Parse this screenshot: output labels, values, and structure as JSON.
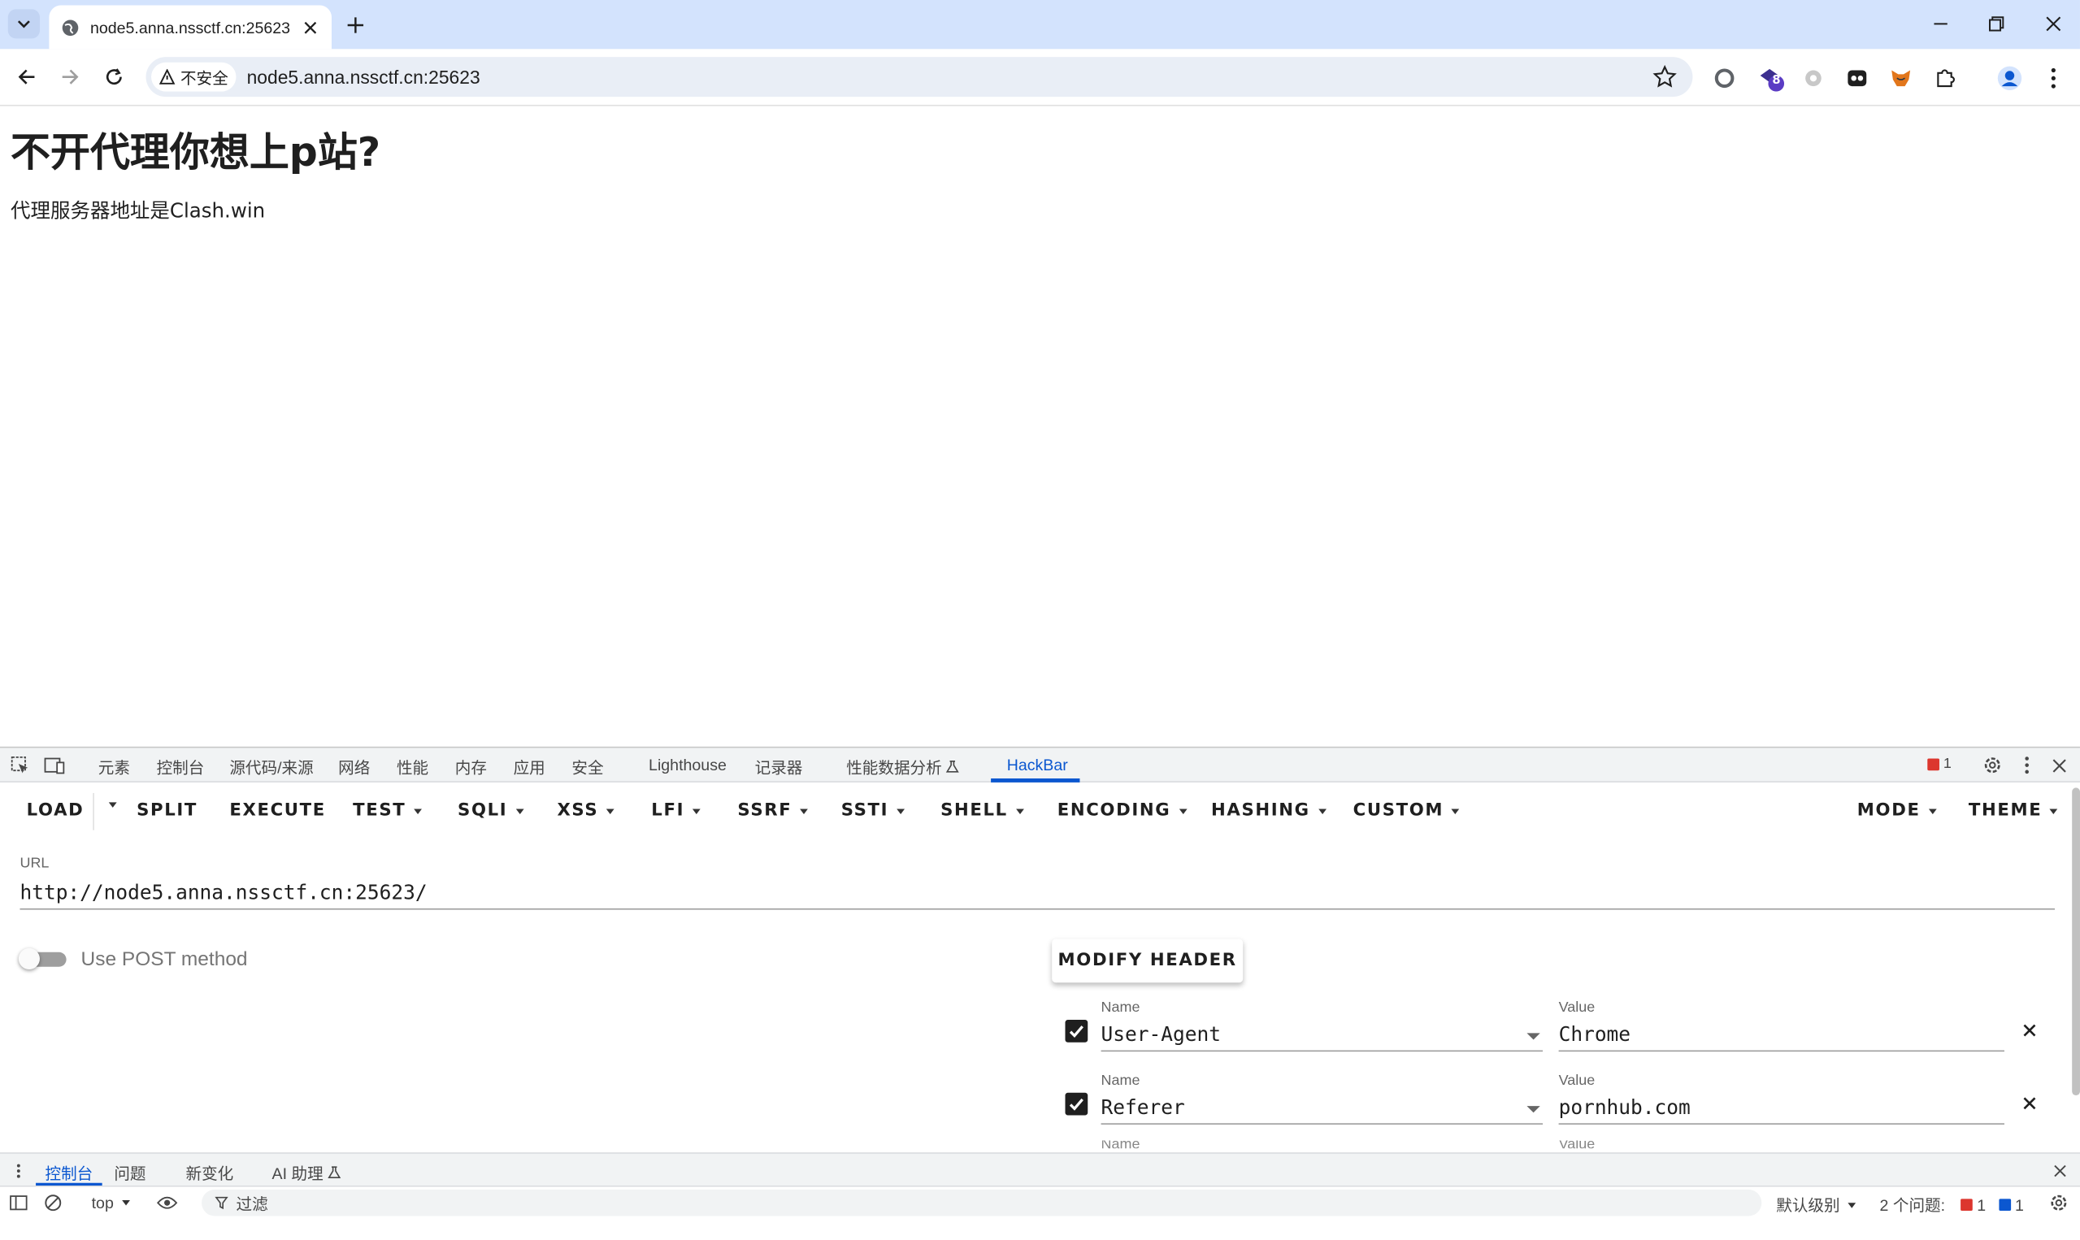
{
  "browser": {
    "tab_title": "node5.anna.nssctf.cn:25623",
    "security_label": "不安全",
    "address": "node5.anna.nssctf.cn:25623",
    "extension_badge": "8"
  },
  "page": {
    "heading": "不开代理你想上p站?",
    "text": "代理服务器地址是Clash.win"
  },
  "devtools": {
    "tabs": [
      "元素",
      "控制台",
      "源代码/来源",
      "网络",
      "性能",
      "内存",
      "应用",
      "安全",
      "Lighthouse",
      "记录器",
      "性能数据分析",
      "HackBar"
    ],
    "active_tab": "HackBar",
    "error_count": "1"
  },
  "hackbar": {
    "menu": [
      "LOAD",
      "SPLIT",
      "EXECUTE",
      "TEST",
      "SQLI",
      "XSS",
      "LFI",
      "SSRF",
      "SSTI",
      "SHELL",
      "ENCODING",
      "HASHING",
      "CUSTOM",
      "MODE",
      "THEME"
    ],
    "url_label": "URL",
    "url_value": "http://node5.anna.nssctf.cn:25623/",
    "post_label": "Use POST method",
    "post_enabled": false,
    "modify_header_label": "MODIFY HEADER",
    "headers": [
      {
        "name_label": "Name",
        "name": "User-Agent",
        "value_label": "Value",
        "value": "Chrome",
        "enabled": true
      },
      {
        "name_label": "Name",
        "name": "Referer",
        "value_label": "Value",
        "value": "pornhub.com",
        "enabled": true
      }
    ],
    "partial_labels": {
      "name": "Name",
      "value": "Value"
    }
  },
  "drawer": {
    "tabs": [
      "控制台",
      "问题",
      "新变化",
      "AI 助理"
    ],
    "active_tab": "控制台"
  },
  "console_bar": {
    "context": "top",
    "filter_placeholder": "过滤",
    "level": "默认级别",
    "issues_text": "2 个问题:",
    "issues_error_count": "1",
    "issues_info_count": "1"
  },
  "colors": {
    "tabstrip": "#d3e3fd",
    "accent": "#0b57d0",
    "error": "#dc362e"
  }
}
